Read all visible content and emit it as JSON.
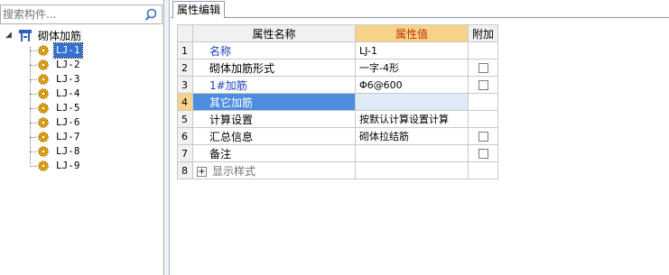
{
  "search": {
    "placeholder": "搜索构件..."
  },
  "tree": {
    "root_label": "砌体加筋",
    "items": [
      {
        "label": "LJ-1",
        "selected": true
      },
      {
        "label": "LJ-2"
      },
      {
        "label": "LJ-3"
      },
      {
        "label": "LJ-4"
      },
      {
        "label": "LJ-5"
      },
      {
        "label": "LJ-6"
      },
      {
        "label": "LJ-7"
      },
      {
        "label": "LJ-8"
      },
      {
        "label": "LJ-9"
      }
    ]
  },
  "tab": {
    "label": "属性编辑"
  },
  "grid": {
    "headers": {
      "name": "属性名称",
      "value": "属性值",
      "extra": "附加"
    },
    "rows": [
      {
        "num": "1",
        "name": "名称",
        "value": "LJ-1",
        "checkbox": false
      },
      {
        "num": "2",
        "name": "砌体加筋形式",
        "value": "一字-4形",
        "checkbox": true
      },
      {
        "num": "3",
        "name": "1#加筋",
        "value": "Φ6@600",
        "checkbox": true
      },
      {
        "num": "4",
        "name": "其它加筋",
        "value": "",
        "checkbox": false
      },
      {
        "num": "5",
        "name": "计算设置",
        "value": "按默认计算设置计算",
        "checkbox": false
      },
      {
        "num": "6",
        "name": "汇总信息",
        "value": "砌体拉结筋",
        "checkbox": true
      },
      {
        "num": "7",
        "name": "备注",
        "value": "",
        "checkbox": true
      },
      {
        "num": "8",
        "name": "显示样式",
        "value": "",
        "checkbox": false,
        "expand": "+"
      }
    ]
  },
  "colors": {
    "selection": "#3472d0",
    "header_value_bg": "#f7d38a",
    "header_value_text": "#c03000",
    "blue_text": "#1f3fbf"
  },
  "icons": {
    "search": "search-icon",
    "root": "element-group-icon",
    "item": "component-gear-icon",
    "expand": "expand-plus-icon",
    "collapse": "collapse-triangle-icon"
  }
}
